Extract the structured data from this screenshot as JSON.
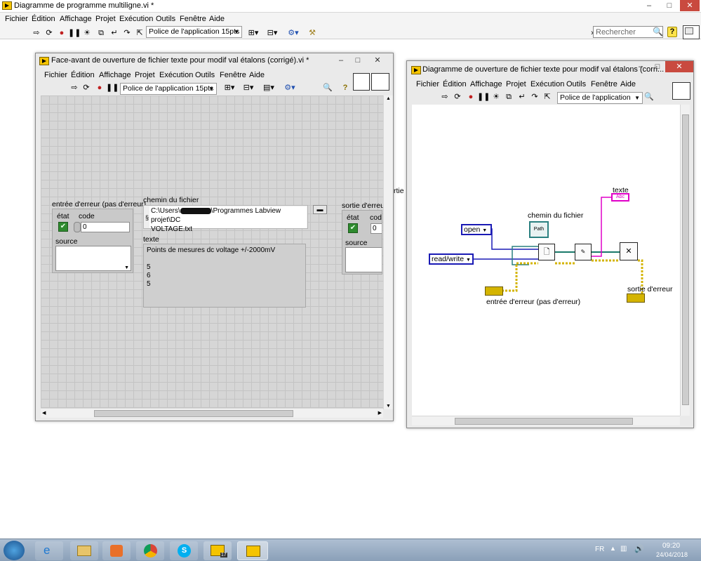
{
  "main_window": {
    "title": "Diagramme de programme multiligne.vi *",
    "menu": [
      "Fichier",
      "Édition",
      "Affichage",
      "Projet",
      "Exécution",
      "Outils",
      "Fenêtre",
      "Aide"
    ],
    "font_selector": "Police de l'application 15pts",
    "search_placeholder": "Rechercher",
    "help_icon": "?"
  },
  "front_panel": {
    "title": "Face-avant de ouverture de fichier texte pour modif val étalons (corrigé).vi *",
    "menu": [
      "Fichier",
      "Édition",
      "Affichage",
      "Projet",
      "Exécution",
      "Outils",
      "Fenêtre",
      "Aide"
    ],
    "font_selector": "Police de l'application 15pts",
    "error_in": {
      "label": "entrée d'erreur (pas d'erreur)",
      "status_label": "état",
      "code_label": "code",
      "code_value": "0",
      "source_label": "source"
    },
    "file_path": {
      "label": "chemin du fichier",
      "value_line1": "C:\\Users\\",
      "value_line1_end": "\\Programmes Labview projet\\DC",
      "value_line2": "VOLTAGE.txt"
    },
    "text": {
      "label": "texte",
      "lines": [
        "Points de mesures dc voltage +/-2000mV",
        "",
        "5",
        "6",
        "5"
      ]
    },
    "error_out": {
      "label": "sortie d'erreur",
      "status_label": "état",
      "code_label": "cod",
      "code_value": "0",
      "source_label": "source"
    },
    "clipped_label": "rtie"
  },
  "block_diagram": {
    "title": "Diagramme de ouverture de fichier texte pour modif val étalons (corri...",
    "menu": [
      "Fichier",
      "Édition",
      "Affichage",
      "Projet",
      "Exécution",
      "Outils",
      "Fenêtre",
      "Aide"
    ],
    "font_selector": "Police de l'application 15pts",
    "labels": {
      "texte": "texte",
      "file_path": "chemin du fichier",
      "error_in": "entrée d'erreur (pas d'erreur)",
      "error_out": "sortie d'erreur"
    },
    "constants": {
      "open": "open",
      "read_write": "read/write"
    },
    "terminal_path_text": "Path",
    "terminal_abc_text": "Abc"
  },
  "taskbar": {
    "language": "FR",
    "time": "09:20",
    "date": "24/04/2018",
    "lv_badge": "17"
  },
  "colors": {
    "error_wire": "#d4b400",
    "string_wire": "#e000c8",
    "refnum_wire": "#1a7a6a",
    "enum_wire": "#1a1ab5",
    "path_wire": "#2a8080"
  }
}
